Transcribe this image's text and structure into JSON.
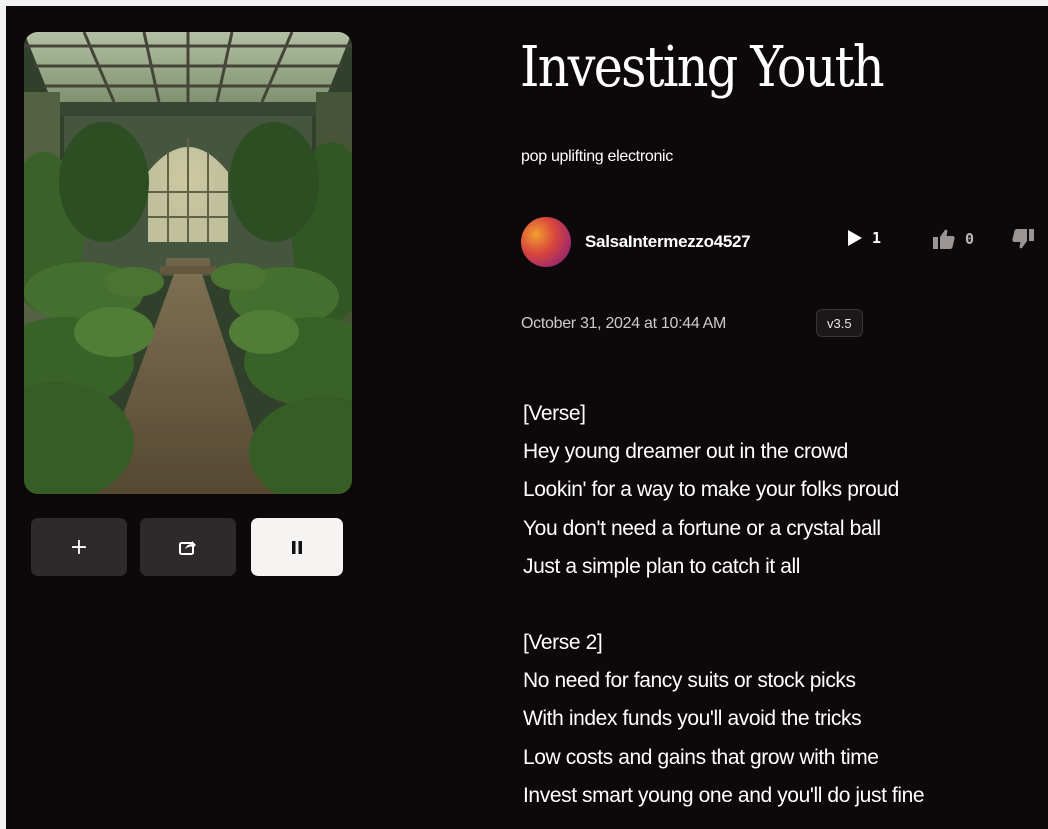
{
  "song": {
    "title": "Investing Youth",
    "genre": "pop uplifting electronic",
    "author": "SalsaIntermezzo4527",
    "plays": "1",
    "likes": "0",
    "date": "October 31, 2024 at 10:44 AM",
    "version": "v3.5"
  },
  "actions": {
    "add_label": "+",
    "share_icon": "share-icon",
    "pause_icon": "pause-icon"
  },
  "lyrics": {
    "verse1_header": "[Verse]",
    "verse1": [
      "Hey young dreamer out in the crowd",
      "Lookin' for a way to make your folks proud",
      "You don't need a fortune or a crystal ball",
      "Just a simple plan to catch it all"
    ],
    "verse2_header": "[Verse 2]",
    "verse2": [
      "No need for fancy suits or stock picks",
      "With index funds you'll avoid the tricks",
      "Low costs and gains that grow with time",
      "Invest smart young one and you'll do just fine"
    ]
  },
  "colors": {
    "background": "#0d0809",
    "button_dark": "#2e2a2b",
    "button_light": "#f6f4f2"
  }
}
